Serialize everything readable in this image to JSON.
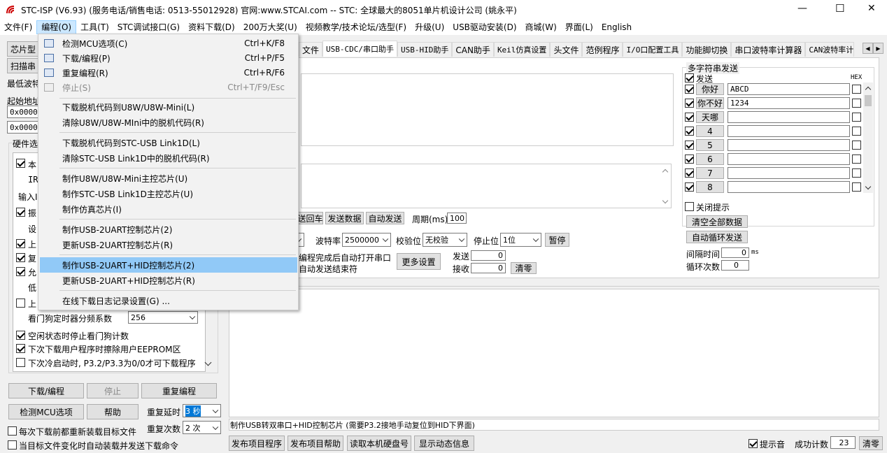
{
  "title": "STC-ISP (V6.93) (服务电话/销售电话: 0513-55012928) 官网:www.STCAI.com  -- STC: 全球最大的8051单片机设计公司 (姚永平)",
  "window_controls": {
    "minimize": "—",
    "maximize": "☐",
    "close": "✕"
  },
  "menu": [
    "文件(F)",
    "编程(O)",
    "工具(T)",
    "STC调试接口(G)",
    "资料下载(D)",
    "200万大奖(U)",
    "视频教学/技术论坛/选型(F)",
    "升级(U)",
    "USB驱动安装(D)",
    "商城(W)",
    "界面(L)",
    "English"
  ],
  "dropdown": {
    "items": [
      {
        "label": "检测MCU选项(C)",
        "key": "Ctrl+K/F8",
        "disabled": false
      },
      {
        "label": "下载/编程(P)",
        "key": "Ctrl+P/F5",
        "disabled": false
      },
      {
        "label": "重复编程(R)",
        "key": "Ctrl+R/F6",
        "disabled": false
      },
      {
        "label": "停止(S)",
        "key": "Ctrl+T/F9/Esc",
        "disabled": true
      },
      {
        "label": "下载脱机代码到U8W/U8W-Mini(L)"
      },
      {
        "label": "清除U8W/U8W-MIni中的脱机代码(R)"
      },
      {
        "label": "下载脱机代码到STC-USB Link1D(L)"
      },
      {
        "label": "清除STC-USB Link1D中的脱机代码(R)"
      },
      {
        "label": "制作U8W/U8W-Mini主控芯片(U)"
      },
      {
        "label": "制作STC-USB Link1D主控芯片(U)"
      },
      {
        "label": "制作仿真芯片(I)"
      },
      {
        "label": "制作USB-2UART控制芯片(2)"
      },
      {
        "label": "更新USB-2UART控制芯片(R)"
      },
      {
        "label": "制作USB-2UART+HID控制芯片(2)"
      },
      {
        "label": "更新USB-2UART+HID控制芯片(R)"
      },
      {
        "label": "在线下载日志记录设置(G) ..."
      }
    ]
  },
  "left": {
    "chip_btn": "芯片型",
    "scan_btn": "扫描串",
    "baud_label": "最低波特",
    "start_addr_label": "起始地址",
    "addr1": "0x0000",
    "addr2": "0x0000",
    "hw_group": "硬件选",
    "opts_partial": [
      "本",
      "IR",
      "输入I",
      "振",
      "设",
      "上",
      "复",
      "允",
      "低",
      "上"
    ],
    "wdt_label": "看门狗定时器分频系数",
    "wdt_value": "256",
    "opt_wdt_idle": "空闲状态时停止看门狗计数",
    "opt_eeprom": "下次下载用户程序时擦除用户EEPROM区",
    "opt_p32": "下次冷启动时, P3.2/P3.3为0/0才可下载程序",
    "btn_download": "下载/编程",
    "btn_stop": "停止",
    "btn_repeat": "重复编程",
    "btn_check": "检测MCU选项",
    "btn_help": "帮助",
    "repeat_delay_label": "重复延时",
    "repeat_delay_value": "3 秒",
    "repeat_count_label": "重复次数",
    "repeat_count_value": "2 次",
    "opt_reload": "每次下载前都重新装载目标文件",
    "opt_autoload": "当目标文件变化时自动装载并发送下载命令"
  },
  "tabs": [
    "文件",
    "USB-CDC/串口助手",
    "USB-HID助手",
    "CAN助手",
    "Keil仿真设置",
    "头文件",
    "范例程序",
    "I/O口配置工具",
    "功能脚切换",
    "串口波特率计算器",
    "CAN波特率计"
  ],
  "serial": {
    "btn_send_back": "送回车",
    "btn_send_data": "发送数据",
    "btn_auto_send": "自动发送",
    "period_label": "周期(ms)",
    "period_value": "100",
    "baud_label": "波特率",
    "baud_value": "2500000",
    "parity_label": "校验位",
    "parity_value": "无校验",
    "stop_label": "停止位",
    "stop_value": "1位",
    "btn_pause": "暂停",
    "note1": "编程完成后自动打开串口",
    "note2": "自动发送结束符",
    "btn_more": "更多设置",
    "send_label": "发送",
    "send_count": "0",
    "recv_label": "接收",
    "recv_count": "0",
    "btn_clear": "清零"
  },
  "multi": {
    "group": "多字符串发送",
    "send_label": "发送",
    "hex_label": "HEX",
    "rows": [
      {
        "name": "你好",
        "value": "ABCD"
      },
      {
        "name": "你不好",
        "value": "1234"
      },
      {
        "name": "天哪",
        "value": ""
      },
      {
        "name": "4",
        "value": ""
      },
      {
        "name": "5",
        "value": ""
      },
      {
        "name": "6",
        "value": ""
      },
      {
        "name": "7",
        "value": ""
      },
      {
        "name": "8",
        "value": ""
      }
    ],
    "close_hint": "关闭提示",
    "btn_clear_all": "清空全部数据",
    "btn_auto_loop": "自动循环发送",
    "interval_label": "间隔时间",
    "interval_value": "0",
    "interval_unit": "ms",
    "loop_label": "循环次数",
    "loop_value": "0"
  },
  "status_text": "制作USB转双串口+HID控制芯片 (需要P3.2接地手动复位到HID下界面)",
  "bottom": {
    "btn_publish": "发布项目程序",
    "btn_publish_help": "发布项目帮助",
    "btn_read_disk": "读取本机硬盘号",
    "btn_show_info": "显示动态信息",
    "beep_label": "提示音",
    "success_label": "成功计数",
    "success_value": "23",
    "btn_clear": "清零"
  }
}
